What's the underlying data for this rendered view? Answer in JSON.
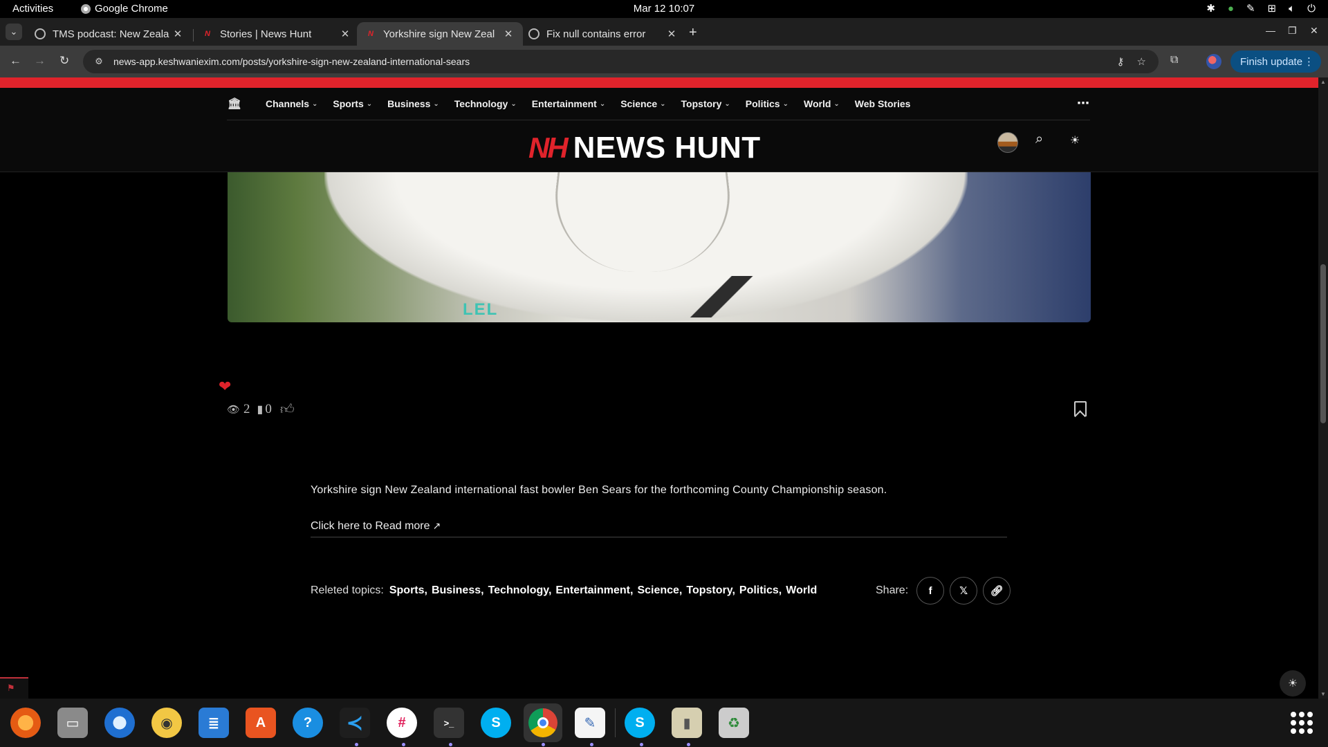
{
  "system": {
    "activities": "Activities",
    "app_name": "Google Chrome",
    "datetime": "Mar 12  10:07"
  },
  "browser": {
    "tabs": [
      {
        "title": "TMS podcast: New Zeala",
        "favicon": "globe-icon",
        "active": false
      },
      {
        "title": "Stories | News Hunt",
        "favicon": "newshunt-icon",
        "active": false
      },
      {
        "title": "Yorkshire sign New Zeal",
        "favicon": "newshunt-icon",
        "active": true
      },
      {
        "title": "Fix null contains error",
        "favicon": "openai-icon",
        "active": false
      }
    ],
    "url": "news-app.keshwaniexim.com/posts/yorkshire-sign-new-zealand-international-sears",
    "finish_update": "Finish update"
  },
  "site": {
    "nav": [
      {
        "label": "Channels"
      },
      {
        "label": "Sports"
      },
      {
        "label": "Business"
      },
      {
        "label": "Technology"
      },
      {
        "label": "Entertainment"
      },
      {
        "label": "Science"
      },
      {
        "label": "Topstory"
      },
      {
        "label": "Politics"
      },
      {
        "label": "World"
      }
    ],
    "nav_web_stories": "Web Stories",
    "logo_mark": "NH",
    "logo_text": "NEWS HUNT",
    "accent_color": "#e0232b"
  },
  "article": {
    "hero_sponsor": "LEL",
    "views": "2",
    "bookmarks": "0",
    "summary": "Yorkshire sign New Zealand international fast bowler Ben Sears for the forthcoming County Championship season.",
    "read_more": "Click here to Read more",
    "related_label": "Releted topics:",
    "topics": [
      "Sports,",
      "Business,",
      "Technology,",
      "Entertainment,",
      "Science,",
      "Topstory,",
      "Politics,",
      "World"
    ],
    "share_label": "Share:",
    "share_buttons": [
      "facebook-icon",
      "x-icon",
      "link-icon"
    ]
  },
  "dock": {
    "apps": [
      "firefox",
      "files",
      "thunderbird",
      "rhythmbox",
      "libreoffice-writer",
      "app-center",
      "help",
      "vscode",
      "slack",
      "terminal",
      "skype",
      "chrome",
      "text-editor",
      "skype",
      "archive-manager",
      "trash"
    ]
  }
}
